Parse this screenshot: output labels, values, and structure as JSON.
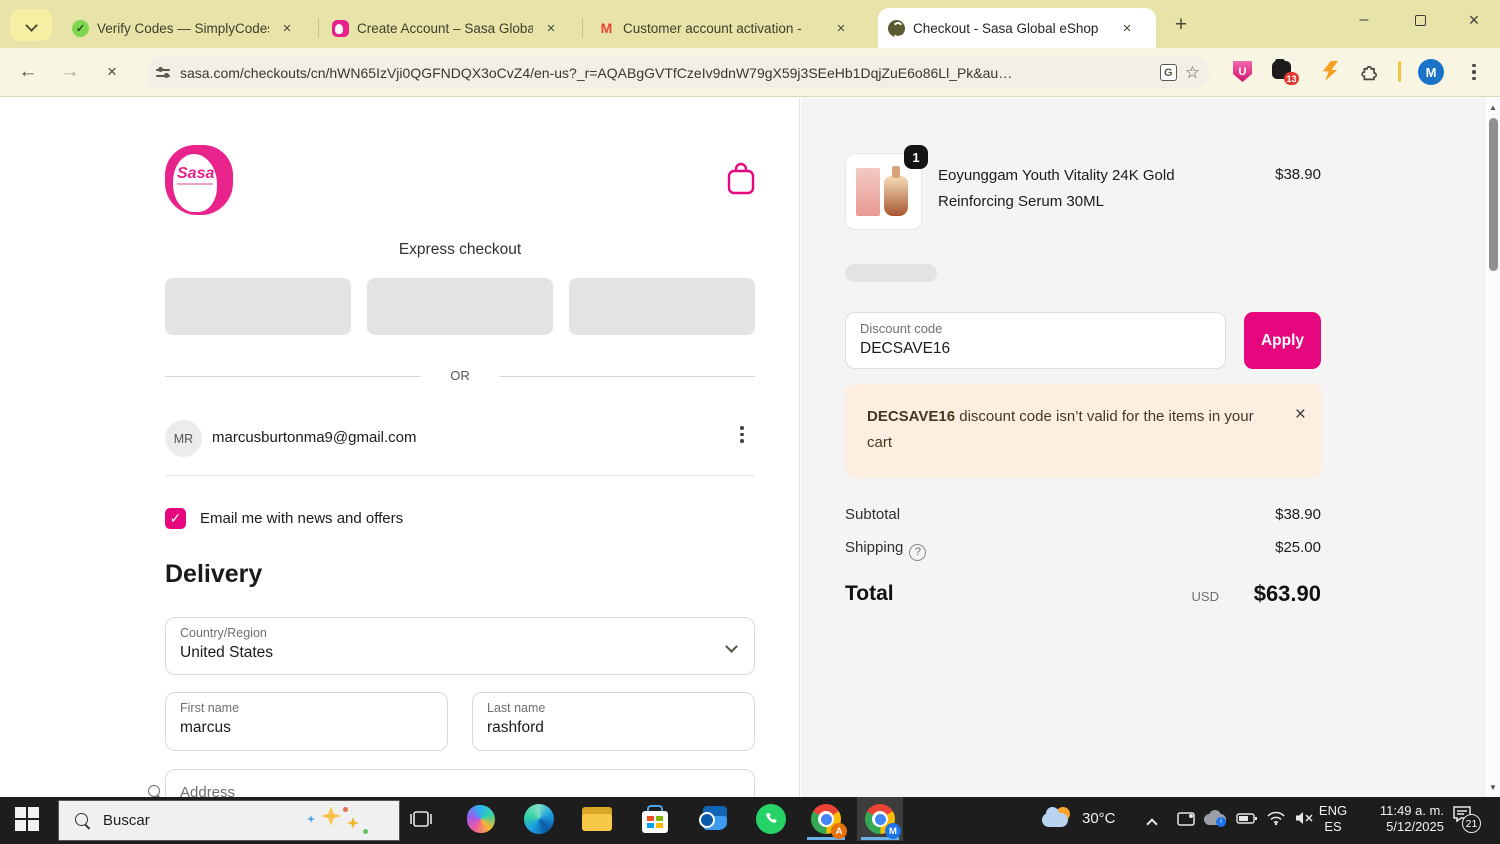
{
  "browser": {
    "tabs": [
      {
        "title": "Verify Codes — SimplyCodes"
      },
      {
        "title": "Create Account – Sasa Global e"
      },
      {
        "title": "Customer account activation -"
      },
      {
        "title": "Checkout - Sasa Global eShop"
      }
    ],
    "close_glyph": "×",
    "new_tab_glyph": "+",
    "window_controls": {
      "minimize": "–",
      "close": "×"
    },
    "nav": {
      "back": "←",
      "forward": "→",
      "stop": "×"
    },
    "url": "sasa.com/checkouts/cn/hWN65IzVji0QGFNDQX3oCvZ4/en-us?_r=AQABgGVTfCzeIv9dnW79gX59j3SEeHb1DqjZuE6o86Ll_Pk&au…",
    "translate_glyph": "G",
    "bookmark_glyph": "☆",
    "shield_letter": "U",
    "ext_badge": "13",
    "profile_initial": "M",
    "favicon_simplycodes_glyph": "✓",
    "favicon_gmail_glyph": "M"
  },
  "page": {
    "brand": "Sasa",
    "express_label": "Express checkout",
    "or_label": "OR",
    "account": {
      "initials": "MR",
      "email": "marcusburtonma9@gmail.com"
    },
    "newsletter": {
      "check_glyph": "✓",
      "label": "Email me with news and offers"
    },
    "delivery_heading": "Delivery",
    "country_label": "Country/Region",
    "country_value": "United States",
    "first_name_label": "First name",
    "first_name_value": "marcus",
    "last_name_label": "Last name",
    "last_name_value": "rashford",
    "address_label": "Address"
  },
  "summary": {
    "qty_badge": "1",
    "item_name": "Eoyunggam Youth Vitality 24K Gold Reinforcing Serum 30ML",
    "item_price": "$38.90",
    "discount_label": "Discount code",
    "discount_value": "DECSAVE16",
    "apply_label": "Apply",
    "alert": {
      "code": "DECSAVE16",
      "rest": " discount code isn’t valid for the items in your cart",
      "close_glyph": "×"
    },
    "subtotal_label": "Subtotal",
    "subtotal_value": "$38.90",
    "shipping_label": "Shipping",
    "help_glyph": "?",
    "shipping_value": "$25.00",
    "total_label": "Total",
    "currency": "USD",
    "total_value": "$63.90"
  },
  "scrollbar": {
    "up_glyph": "▲",
    "down_glyph": "▼"
  },
  "taskbar": {
    "search_placeholder": "Buscar",
    "weather_temp": "30°C",
    "lang_primary": "ENG",
    "lang_secondary": "ES",
    "time": "11:49 a. m.",
    "date": "5/12/2025",
    "notif_count": "21"
  },
  "colors": {
    "brand_pink": "#e6077e",
    "alert_bg": "#fcefe1",
    "taskbar_accent": "#6cb2e8",
    "tabstrip_bg": "#e8e4a9"
  }
}
